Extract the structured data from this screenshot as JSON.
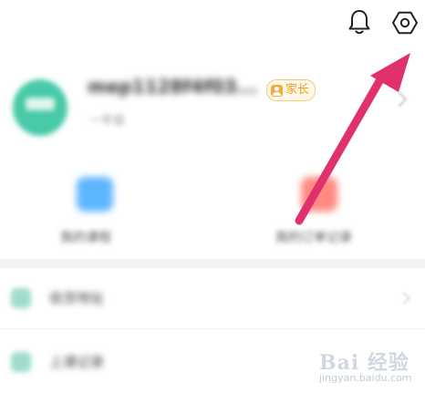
{
  "topbar": {
    "icons": [
      "bell-icon",
      "settings-icon"
    ]
  },
  "profile": {
    "username": "mep1128f4f03...",
    "subtext": "一年级",
    "role_badge": "家长",
    "colors": {
      "badge_text": "#ec9f22",
      "badge_border": "#f5c875",
      "avatar": "#48c9a8"
    }
  },
  "quick_actions": [
    {
      "label": "我的课程",
      "icon": "book-icon",
      "color": "#5eb6ff"
    },
    {
      "label": "我的订单记录",
      "icon": "order-icon",
      "color": "#ff8a80"
    }
  ],
  "list": [
    {
      "label": "收货地址",
      "icon": "location-icon"
    },
    {
      "label": "上课记录",
      "icon": "record-icon"
    }
  ],
  "annotation": {
    "type": "arrow",
    "color": "#e0306e",
    "target": "settings-icon"
  },
  "watermark": {
    "brand": "Bai 经验",
    "url": "jingyan.baidu.com"
  }
}
